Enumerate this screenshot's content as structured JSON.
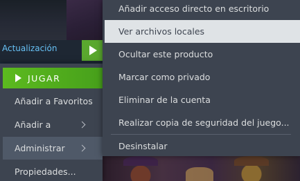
{
  "header": {
    "update_label": "Actualización"
  },
  "left_menu": {
    "play_label": "JUGAR",
    "items": [
      {
        "label": "Añadir a Favoritos",
        "has_submenu": false
      },
      {
        "label": "Añadir a",
        "has_submenu": true
      },
      {
        "label": "Administrar",
        "has_submenu": true,
        "active": true
      },
      {
        "label": "Propiedades...",
        "has_submenu": false
      }
    ]
  },
  "sub_menu": {
    "items": [
      {
        "label": "Añadir acceso directo en escritorio"
      },
      {
        "label": "Ver archivos locales",
        "highlighted": true
      },
      {
        "label": "Ocultar este producto"
      },
      {
        "label": "Marcar como privado"
      },
      {
        "label": "Eliminar de la cuenta"
      },
      {
        "label": "Realizar copia de seguridad del juego..."
      },
      {
        "label": "Desinstalar"
      }
    ]
  },
  "colors": {
    "menu_bg": "#3d4450",
    "highlight_bg": "#dfe3e6",
    "play_green": "#5cba1f",
    "link_blue": "#67c1f5"
  }
}
